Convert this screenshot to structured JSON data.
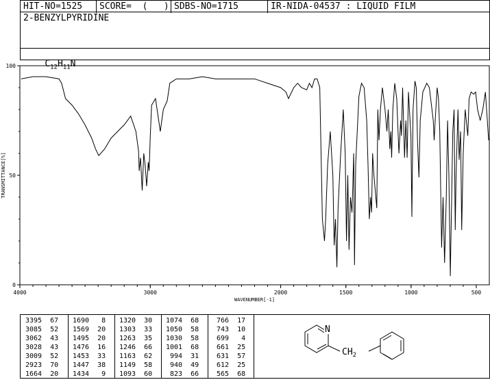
{
  "header": {
    "hit_no": "HIT-NO=1525",
    "score": "SCORE=  (   )",
    "sdbs_no": "SDBS-NO=1715",
    "ir_id": "IR-NIDA-04537 : LIQUID FILM"
  },
  "compound": {
    "name": "2-BENZYLPYRIDINE",
    "formula_c": "C",
    "formula_c_sub": "12",
    "formula_h": "H",
    "formula_h_sub": "11",
    "formula_n": "N"
  },
  "structure": {
    "n_label": "N",
    "ch2_label": "CH",
    "ch2_sub": "2"
  },
  "chart_data": {
    "type": "line",
    "xlabel": "WAVENUMBER[-1]",
    "ylabel": "TRANSMITTANCE[%]",
    "xlim": [
      4000,
      400
    ],
    "ylim": [
      0,
      100
    ],
    "xticks": [
      "4000",
      "3000",
      "2000",
      "1500",
      "1000",
      "500"
    ],
    "yticks": [
      "100",
      "50",
      "0"
    ],
    "series": [
      {
        "x": [
          3990,
          3900,
          3800,
          3700,
          3680,
          3650,
          3600,
          3550,
          3500,
          3450,
          3420,
          3395,
          3350,
          3300,
          3250,
          3200,
          3150,
          3110,
          3090,
          3085,
          3075,
          3062,
          3050,
          3040,
          3028,
          3015,
          3009,
          3000,
          2990,
          2960,
          2923,
          2900,
          2870,
          2850,
          2800,
          2700,
          2600,
          2500,
          2400,
          2300,
          2200,
          2100,
          2000,
          1960,
          1940,
          1900,
          1870,
          1840,
          1800,
          1780,
          1760,
          1740,
          1720,
          1700,
          1690,
          1680,
          1664,
          1655,
          1640,
          1620,
          1600,
          1590,
          1580,
          1569,
          1560,
          1540,
          1520,
          1505,
          1495,
          1485,
          1476,
          1465,
          1453,
          1447,
          1440,
          1434,
          1425,
          1400,
          1380,
          1360,
          1340,
          1330,
          1320,
          1310,
          1303,
          1295,
          1285,
          1263,
          1255,
          1246,
          1235,
          1220,
          1200,
          1185,
          1175,
          1163,
          1155,
          1149,
          1140,
          1125,
          1110,
          1093,
          1080,
          1074,
          1065,
          1050,
          1040,
          1030,
          1020,
          1001,
          994,
          985,
          970,
          960,
          950,
          940,
          930,
          910,
          880,
          860,
          840,
          830,
          823,
          815,
          800,
          790,
          780,
          766,
          755,
          743,
          730,
          720,
          710,
          699,
          690,
          680,
          670,
          661,
          655,
          640,
          631,
          620,
          612,
          600,
          585,
          565,
          555,
          540,
          520,
          505,
          490,
          470,
          450,
          430,
          415,
          405
        ],
        "y": [
          94,
          95,
          95,
          94,
          92,
          85,
          82,
          78,
          73,
          67,
          62,
          59,
          62,
          67,
          70,
          73,
          77,
          70,
          61,
          52,
          58,
          43,
          60,
          55,
          45,
          56,
          52,
          68,
          82,
          85,
          70,
          80,
          84,
          92,
          94,
          94,
          95,
          94,
          94,
          94,
          94,
          92,
          90,
          88,
          85,
          90,
          92,
          90,
          89,
          92,
          90,
          94,
          94,
          90,
          60,
          30,
          20,
          30,
          55,
          70,
          50,
          18,
          30,
          8,
          35,
          60,
          80,
          60,
          20,
          50,
          16,
          40,
          33,
          45,
          60,
          9,
          55,
          86,
          92,
          90,
          75,
          55,
          30,
          40,
          33,
          60,
          50,
          35,
          80,
          66,
          80,
          90,
          80,
          70,
          80,
          62,
          70,
          58,
          80,
          92,
          85,
          60,
          75,
          68,
          90,
          58,
          75,
          58,
          88,
          68,
          31,
          80,
          93,
          90,
          65,
          49,
          75,
          88,
          92,
          90,
          80,
          75,
          66,
          75,
          90,
          85,
          70,
          17,
          40,
          10,
          40,
          75,
          50,
          4,
          35,
          70,
          80,
          25,
          50,
          80,
          57,
          70,
          25,
          60,
          80,
          68,
          85,
          88,
          87,
          88,
          80,
          75,
          80,
          88,
          75,
          66
        ]
      }
    ]
  },
  "peaks": {
    "col1": [
      "3395  67",
      "3085  52",
      "3062  43",
      "3028  43",
      "3009  52",
      "2923  70",
      "1664  20"
    ],
    "col2": [
      "1690   8",
      "1569  20",
      "1495  20",
      "1476  16",
      "1453  33",
      "1447  38",
      "1434   9"
    ],
    "col3": [
      "1320  30",
      "1303  33",
      "1263  35",
      "1246  66",
      "1163  62",
      "1149  58",
      "1093  60"
    ],
    "col4": [
      "1074  68",
      "1050  58",
      "1030  58",
      "1001  68",
      " 994  31",
      " 940  49",
      " 823  66"
    ],
    "col5": [
      " 766  17",
      " 743  10",
      " 699   4",
      " 661  25",
      " 631  57",
      " 612  25",
      " 565  68"
    ]
  }
}
